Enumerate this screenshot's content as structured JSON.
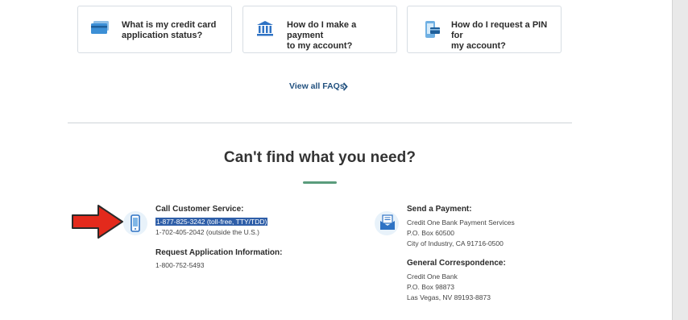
{
  "faq": {
    "cards": [
      {
        "label_1": "What is my credit card",
        "label_2": "application status?",
        "icon": "credit-card-icon"
      },
      {
        "label_1": "How do I make a payment",
        "label_2": "to my account?",
        "icon": "bank-icon"
      },
      {
        "label_1": "How do I request a PIN for",
        "label_2": "my account?",
        "icon": "phone-card-icon"
      }
    ],
    "view_all": "View all FAQs"
  },
  "contact": {
    "headline": "Can't find what you need?",
    "call": {
      "title": "Call Customer Service:",
      "phone_tollfree": "1-877-825-3242 (toll-free, TTY/TDD)",
      "phone_outside": "1-702-405-2042 (outside the U.S.)"
    },
    "app_info": {
      "title": "Request Application Information:",
      "phone": "1-800-752-5493"
    },
    "payment": {
      "title": "Send a Payment:",
      "line1": "Credit One Bank Payment Services",
      "line2": "P.O. Box 60500",
      "line3": "City of Industry, CA 91716-0500"
    },
    "correspondence": {
      "title": "General Correspondence:",
      "line1": "Credit One Bank",
      "line2": "P.O. Box 98873",
      "line3": "Las Vegas, NV 89193-8873"
    }
  },
  "colors": {
    "link": "#22517f",
    "accent": "#5a9c7c",
    "annotation_arrow": "#e32a1c",
    "selection": "#2e5ea8"
  }
}
